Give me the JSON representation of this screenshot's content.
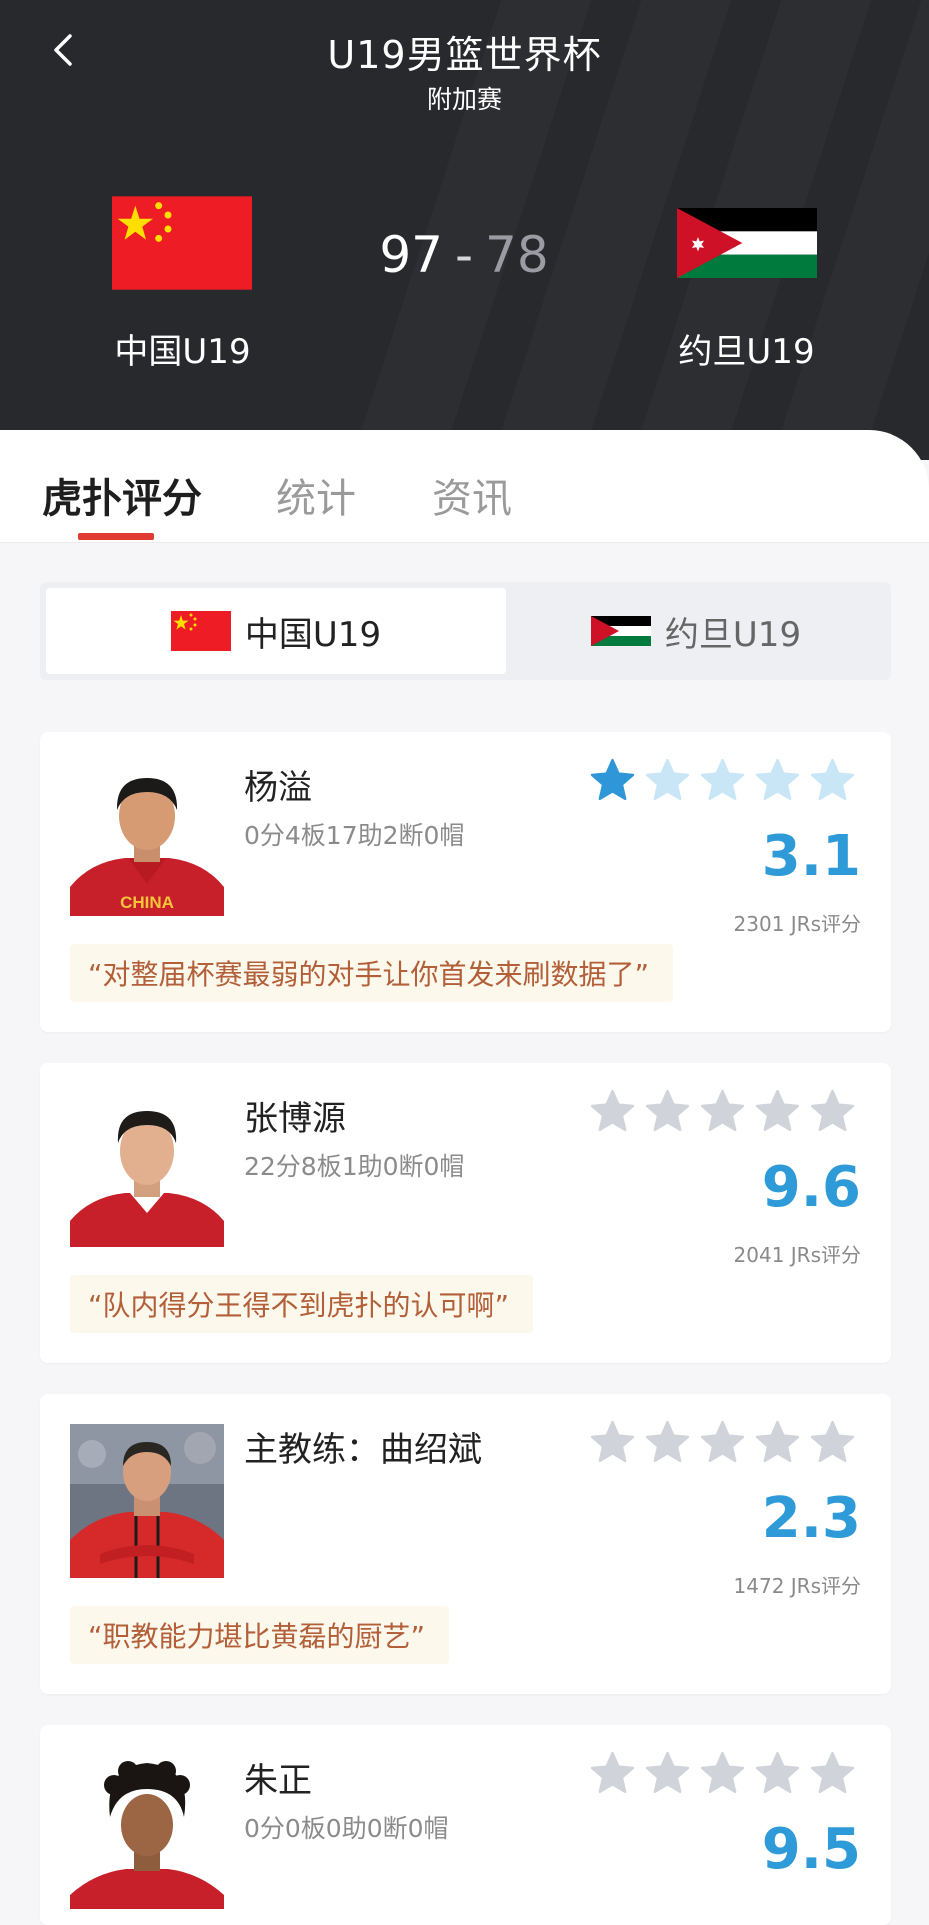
{
  "header": {
    "title": "U19男篮世界杯",
    "subtitle": "附加赛",
    "home_team": "中国U19",
    "away_team": "约旦U19",
    "home_score": "97",
    "away_score": "78",
    "score_separator": "-"
  },
  "tabs": [
    {
      "label": "虎扑评分",
      "active": true
    },
    {
      "label": "统计",
      "active": false
    },
    {
      "label": "资讯",
      "active": false
    }
  ],
  "team_switch": {
    "home": "中国U19",
    "away": "约旦U19",
    "active": "home"
  },
  "players": [
    {
      "name": "杨溢",
      "stats": "0分4板17助2断0帽",
      "rating": "3.1",
      "votes": "2301 JRs评分",
      "comment": "“对整届杯赛最弱的对手让你首发来刷数据了”",
      "user_stars": 1
    },
    {
      "name": "张博源",
      "stats": "22分8板1助0断0帽",
      "rating": "9.6",
      "votes": "2041 JRs评分",
      "comment": "“队内得分王得不到虎扑的认可啊”",
      "user_stars": 0
    },
    {
      "name": "主教练：曲绍斌",
      "stats": "",
      "rating": "2.3",
      "votes": "1472 JRs评分",
      "comment": "“职教能力堪比黄磊的厨艺”",
      "user_stars": 0
    },
    {
      "name": "朱正",
      "stats": "0分0板0助0断0帽",
      "rating": "9.5",
      "votes": "",
      "comment": "",
      "user_stars": 0
    }
  ],
  "colors": {
    "header_bg": "#28292d",
    "accent_red": "#e03a33",
    "rating_blue": "#2e9bd8",
    "star_active": "#2f96d8",
    "star_light": "#c9e6f6",
    "star_grey": "#d0d3d9",
    "comment_text": "#b25f3a",
    "comment_bg": "#fcf8ec"
  },
  "icons": {
    "back": "chevron-left-icon",
    "star": "star-icon"
  }
}
